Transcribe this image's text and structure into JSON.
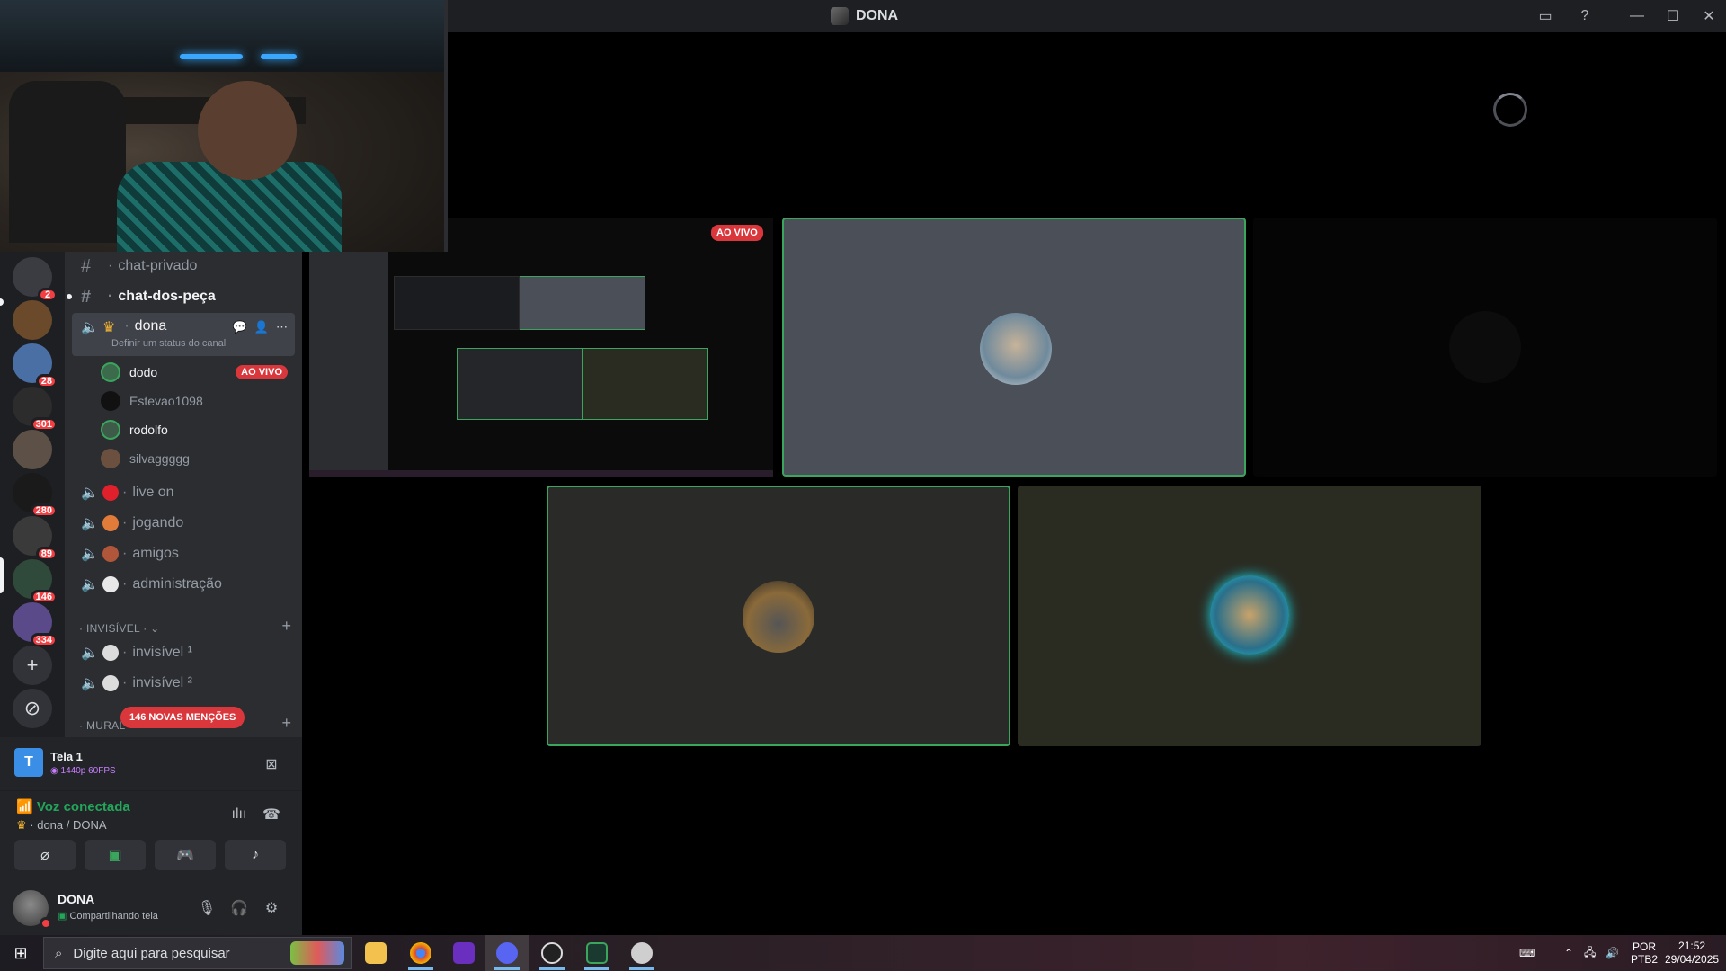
{
  "window": {
    "title": "DONA"
  },
  "servers": [
    {
      "badge": "2",
      "color": "#3a3c42"
    },
    {
      "badge": "",
      "color": "#6b4a2c"
    },
    {
      "badge": "28",
      "color": "#4a6fa5"
    },
    {
      "badge": "301",
      "color": "#2c2c2c"
    },
    {
      "badge": "",
      "color": "#5d5147"
    },
    {
      "badge": "280",
      "color": "#1a1a1a"
    },
    {
      "badge": "89",
      "color": "#3a3a3a"
    },
    {
      "badge": "146",
      "color": "#2f4a3a"
    },
    {
      "badge": "334",
      "color": "#5a4a8a"
    }
  ],
  "channels": {
    "chat_privado": "chat-privado",
    "chat_dos_peca": "chat-dos-peça",
    "dona": "dona",
    "dona_status": "Definir um status do canal",
    "users": [
      {
        "name": "dodo",
        "live": "AO VIVO",
        "color": "#3b6b4a"
      },
      {
        "name": "Estevao1098",
        "live": "",
        "color": "#111111"
      },
      {
        "name": "rodolfo",
        "live": "",
        "color": "#3e5a48"
      },
      {
        "name": "silvaggggg",
        "live": "",
        "color": "#6b5040"
      }
    ],
    "live_on": "live on",
    "jogando": "jogando",
    "amigos": "amigos",
    "administracao": "administração",
    "category_invisivel": "INVISÍVEL",
    "invisivel_1": "invisível ¹",
    "invisivel_2": "invisível ²",
    "category_mural": "MURAL",
    "mentions": "146 NOVAS MENÇÕES"
  },
  "stream_card": {
    "title": "Tela 1",
    "quality": "1440p 60FPS",
    "icon_letter": "T"
  },
  "voice": {
    "status": "Voz conectada",
    "channel": "dona / DONA"
  },
  "me": {
    "name": "DONA",
    "status": "Compartilhando tela"
  },
  "stage": {
    "live_badge": "AO VIVO"
  },
  "taskbar": {
    "search_placeholder": "Digite aqui para pesquisar",
    "lang": "POR",
    "layout": "PTB2",
    "time": "21:52",
    "date": "29/04/2025"
  },
  "colors": {
    "accent_green": "#3ba55d",
    "live_red": "#da373c",
    "tile_gray": "#4b4f57",
    "tile_olive": "#2a2c22"
  }
}
